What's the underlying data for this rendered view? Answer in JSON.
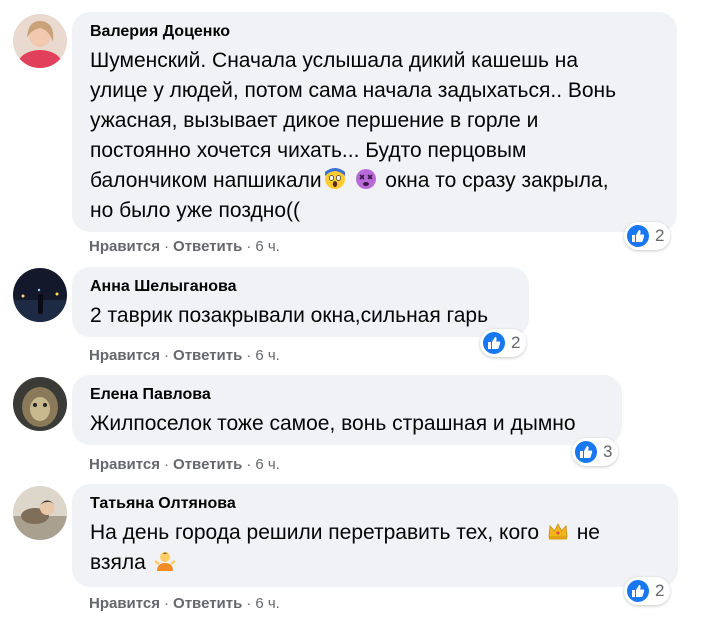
{
  "comments": [
    {
      "author": "Валерия Доценко",
      "lines": [
        "Шуменский. Сначала услышала дикий кашешь на",
        "улице у людей, потом сама начала задыхаться.. Вонь",
        "ужасная, вызывает дикое першение в горле и",
        "постоянно хочется чихать... Будто перцовым",
        "балончиком напшикали",
        "окна то сразу закрыла,",
        "но было уже поздно(("
      ],
      "emoji": [
        "face-screaming-emoji",
        "dizzy-face-emoji"
      ],
      "like": "Нравится",
      "reply": "Ответить",
      "time": "6 ч.",
      "reactions": "2"
    },
    {
      "author": "Анна Шелыганова",
      "lines": [
        "2 таврик позакрывали окна,сильная гарь"
      ],
      "like": "Нравится",
      "reply": "Ответить",
      "time": "6 ч.",
      "reactions": "2"
    },
    {
      "author": "Елена Павлова",
      "lines": [
        "Жилпоселок тоже самое, вонь страшная и дымно"
      ],
      "like": "Нравится",
      "reply": "Ответить",
      "time": "6 ч.",
      "reactions": "3"
    },
    {
      "author": "Татьяна Олтянова",
      "lines": [
        "На день города решили перетравить тех, кого",
        "не",
        "взяла"
      ],
      "emoji": [
        "crown-emoji",
        "person-shrugging-emoji"
      ],
      "like": "Нравится",
      "reply": "Ответить",
      "time": "6 ч.",
      "reactions": "2"
    }
  ],
  "colors": {
    "bubble": "#f0f2f5",
    "secondary_text": "#65676b",
    "like_blue": "#1877f2"
  }
}
